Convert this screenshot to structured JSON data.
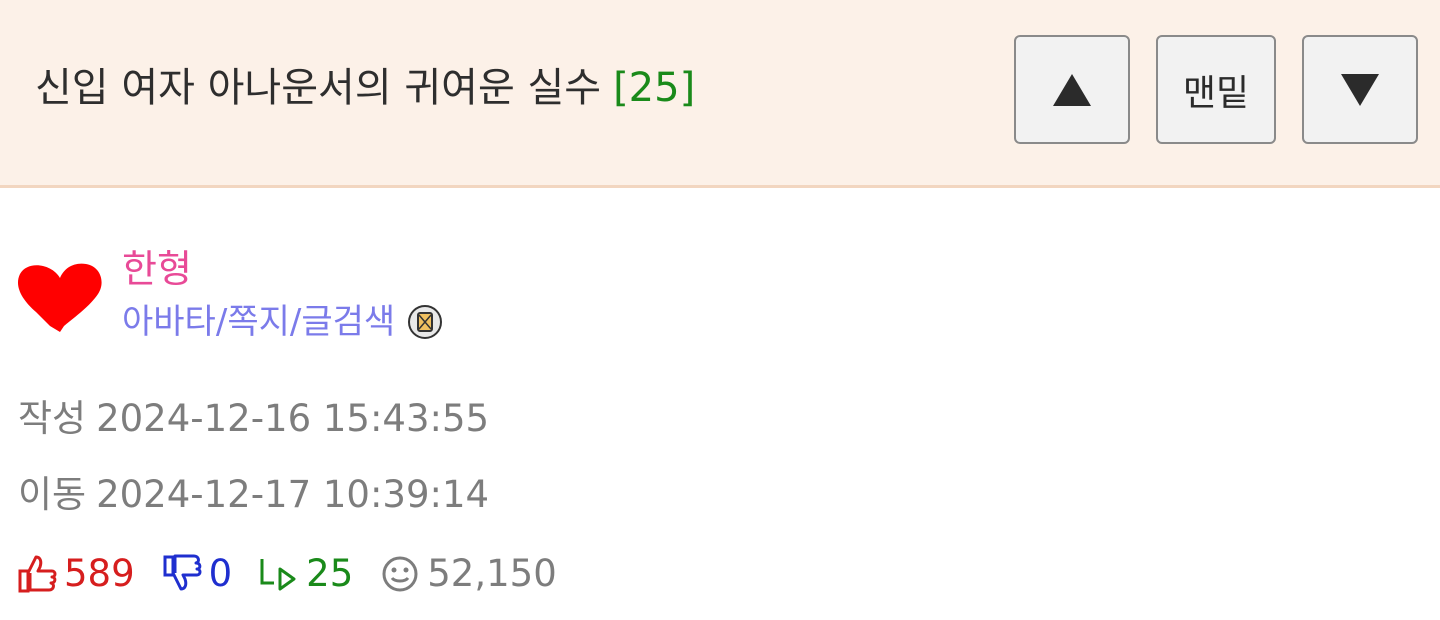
{
  "post": {
    "title": "신입 여자 아나운서의 귀여운 실수",
    "comment_count": "[25]"
  },
  "nav": {
    "up_icon": "triangle-up-icon",
    "bottom_label": "맨밑",
    "down_icon": "triangle-down-icon"
  },
  "author": {
    "avatar_icon": "heart-icon",
    "name": "한형",
    "links": {
      "avatar": "아바타",
      "message": "쪽지",
      "search": "글검색",
      "separator": "/"
    },
    "badge_icon": "letter-badge-icon"
  },
  "meta": {
    "written_label": "작성",
    "written_time": "2024-12-16 15:43:55",
    "moved_label": "이동",
    "moved_time": "2024-12-17 10:39:14"
  },
  "stats": {
    "likes": "589",
    "dislikes": "0",
    "replies": "25",
    "views": "52,150"
  },
  "colors": {
    "header_bg": "#fcf1e8",
    "username": "#e84a97",
    "links": "#7b7bea",
    "like": "#d61e1e",
    "dislike": "#1f2fcf",
    "reply": "#1a8a1a",
    "muted": "#7d7d7d"
  }
}
